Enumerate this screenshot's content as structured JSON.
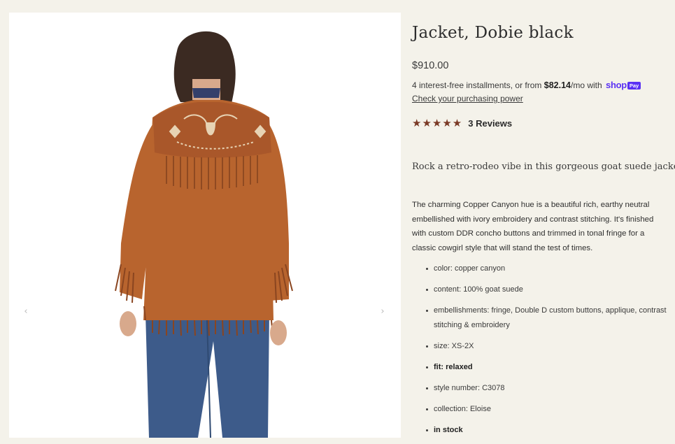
{
  "product": {
    "title": "Jacket, Dobie black",
    "price": "$910.00",
    "installments": {
      "prefix": "4 interest-free installments, or from",
      "amount": "$82.14",
      "suffix": "/mo with",
      "provider": "shop",
      "provider_badge": "Pay"
    },
    "purchasing_power_link": "Check your purchasing power",
    "rating": {
      "stars": "★★★★★",
      "value": 5,
      "reviews_label": "3 Reviews"
    },
    "tagline": "Rock a retro-rodeo vibe in this gorgeous goat suede jacket!",
    "description": "The charming Copper Canyon hue is a beautiful rich, earthy neutral embellished with ivory embroidery and contrast stitching. It's finished with custom DDR concho buttons and trimmed in tonal fringe for a classic cowgirl style that will stand the test of times.",
    "specs": [
      {
        "text": "color: copper canyon",
        "bold": false
      },
      {
        "text": "content: 100% goat suede",
        "bold": false
      },
      {
        "text": "embellishments: fringe, Double D custom buttons, applique, contrast stitching & embroidery",
        "bold": false
      },
      {
        "text": "size: XS-2X",
        "bold": false
      },
      {
        "text": "fit: relaxed",
        "bold": true
      },
      {
        "text": "style number: C3078",
        "bold": false
      },
      {
        "text": "collection: Eloise",
        "bold": false
      },
      {
        "text": "in stock",
        "bold": true
      }
    ]
  },
  "gallery": {
    "prev_icon": "‹",
    "next_icon": "›"
  },
  "colors": {
    "page_bg": "#f4f2ea",
    "star": "#7a3a26",
    "shop_pay": "#5a31f4",
    "jacket": "#b8642e"
  }
}
